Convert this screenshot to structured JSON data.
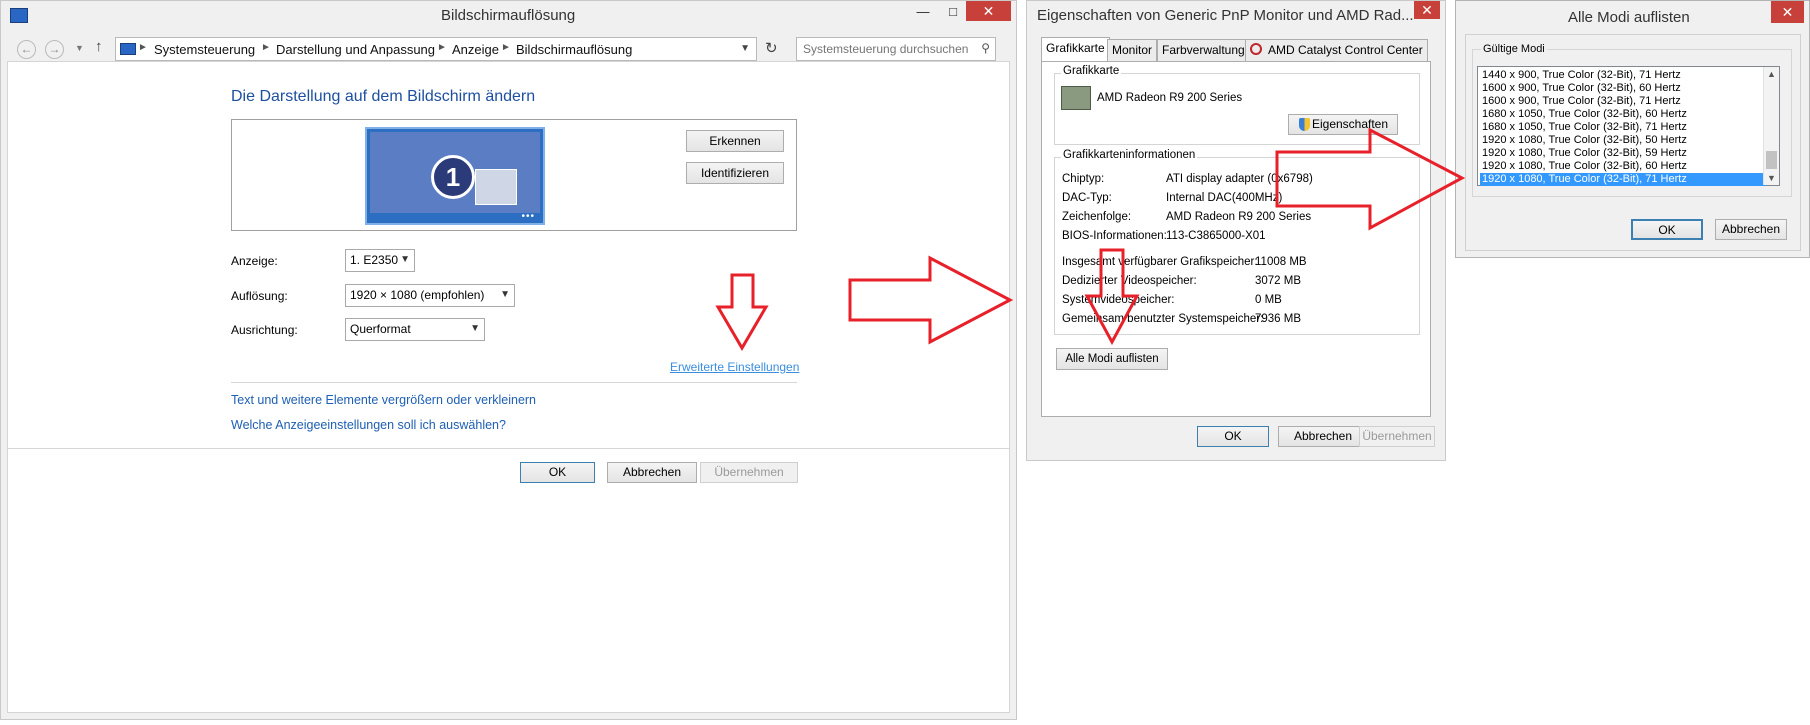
{
  "win1": {
    "title": "Bildschirmauflösung",
    "breadcrumbs": [
      "Systemsteuerung",
      "Darstellung und Anpassung",
      "Anzeige",
      "Bildschirmauflösung"
    ],
    "search_placeholder": "Systemsteuerung durchsuchen",
    "heading": "Die Darstellung auf dem Bildschirm ändern",
    "monitor_number": "1",
    "detect_label": "Erkennen",
    "identify_label": "Identifizieren",
    "display_label": "Anzeige:",
    "display_value": "1. E2350",
    "resolution_label": "Auflösung:",
    "resolution_value": "1920 × 1080 (empfohlen)",
    "orientation_label": "Ausrichtung:",
    "orientation_value": "Querformat",
    "advanced_link": "Erweiterte Einstellungen",
    "link_text_size": "Text und weitere Elemente vergrößern oder verkleinern",
    "link_which_settings": "Welche Anzeigeeinstellungen soll ich auswählen?",
    "ok": "OK",
    "cancel": "Abbrechen",
    "apply": "Übernehmen"
  },
  "win2": {
    "title": "Eigenschaften von Generic PnP Monitor und AMD Rad...",
    "tabs": [
      "Grafikkarte",
      "Monitor",
      "Farbverwaltung",
      "AMD Catalyst Control Center"
    ],
    "adapter_group": "Grafikkarte",
    "adapter_name": "AMD Radeon R9 200 Series",
    "properties_button": "Eigenschaften",
    "info_group": "Grafikkarteninformationen",
    "info": [
      {
        "label": "Chiptyp:",
        "value": "ATI display adapter (0x6798)"
      },
      {
        "label": "DAC-Typ:",
        "value": "Internal DAC(400MHz)"
      },
      {
        "label": "Zeichenfolge:",
        "value": "AMD Radeon R9 200 Series"
      },
      {
        "label": "BIOS-Informationen:",
        "value": "113-C3865000-X01"
      }
    ],
    "memory": [
      {
        "label": "Insgesamt verfügbarer Grafikspeicher:",
        "value": "11008 MB"
      },
      {
        "label": "Dedizierter Videospeicher:",
        "value": "3072 MB"
      },
      {
        "label": "Systemvideospeicher:",
        "value": "0 MB"
      },
      {
        "label": "Gemeinsam benutzter Systemspeicher:",
        "value": "7936 MB"
      }
    ],
    "list_all_modes": "Alle Modi auflisten",
    "ok": "OK",
    "cancel": "Abbrechen",
    "apply": "Übernehmen"
  },
  "win3": {
    "title": "Alle Modi auflisten",
    "group_label": "Gültige Modi",
    "modes": [
      "1440 x 900, True Color (32-Bit), 71 Hertz",
      "1600 x 900, True Color (32-Bit), 60 Hertz",
      "1600 x 900, True Color (32-Bit), 71 Hertz",
      "1680 x 1050, True Color (32-Bit), 60 Hertz",
      "1680 x 1050, True Color (32-Bit), 71 Hertz",
      "1920 x 1080, True Color (32-Bit), 50 Hertz",
      "1920 x 1080, True Color (32-Bit), 59 Hertz",
      "1920 x 1080, True Color (32-Bit), 60 Hertz",
      "1920 x 1080, True Color (32-Bit), 71 Hertz"
    ],
    "selected_mode_index": 8,
    "ok": "OK",
    "cancel": "Abbrechen"
  },
  "colors": {
    "annotation_arrow": "#e8202a",
    "heading": "#1e4fa0",
    "link": "#1e5fb3",
    "selection": "#3399ff",
    "close_button": "#c7403a"
  }
}
